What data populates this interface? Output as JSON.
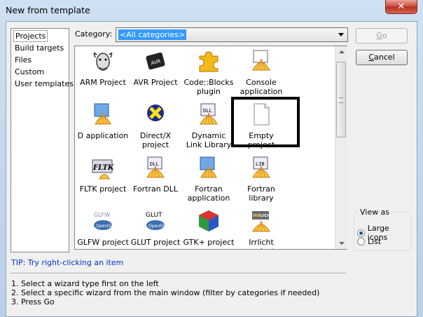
{
  "window": {
    "title": "New from template",
    "close_glyph": "✕"
  },
  "sidebar": {
    "items": [
      {
        "label": "Projects",
        "selected": true
      },
      {
        "label": "Build targets"
      },
      {
        "label": "Files"
      },
      {
        "label": "Custom"
      },
      {
        "label": "User templates"
      }
    ]
  },
  "category": {
    "label": "Category:",
    "value": "<All categories>"
  },
  "templates": [
    {
      "label": "ARM Project",
      "icon": "gnu-icon"
    },
    {
      "label": "AVR Project",
      "icon": "avr-chip-icon"
    },
    {
      "label": "Code::Blocks plugin",
      "icon": "puzzle-icon"
    },
    {
      "label": "Console application",
      "icon": "console-app-icon"
    },
    {
      "label": "D application",
      "icon": "d-app-icon"
    },
    {
      "label": "Direct/X project",
      "icon": "directx-icon"
    },
    {
      "label": "Dynamic Link Library",
      "icon": "dll-icon"
    },
    {
      "label": "Empty project",
      "icon": "blank-page-icon",
      "highlighted": true
    },
    {
      "label": "FLTK project",
      "icon": "fltk-icon"
    },
    {
      "label": "Fortran DLL",
      "icon": "fortran-dll-icon"
    },
    {
      "label": "Fortran application",
      "icon": "fortran-app-icon"
    },
    {
      "label": "Fortran library",
      "icon": "fortran-lib-icon"
    },
    {
      "label": "GLFW project",
      "icon": "glfw-icon"
    },
    {
      "label": "GLUT project",
      "icon": "glut-icon"
    },
    {
      "label": "GTK+ project",
      "icon": "gtk-icon"
    },
    {
      "label": "Irrlicht project",
      "icon": "irrlicht-icon"
    }
  ],
  "icon_text": {
    "avr": "AVR",
    "dll": "DLL",
    "lib": "LIB",
    "fltk": "FLTK",
    "glfw": "GLFW",
    "opengl": "OpenGL",
    "glut": "GLUT",
    "irr": "IRR",
    "licht": "LICHT"
  },
  "buttons": {
    "go": "Go",
    "cancel": "Cancel"
  },
  "view_as": {
    "legend": "View as",
    "options": [
      {
        "label": "Large icons",
        "selected": true
      },
      {
        "label": "List",
        "selected": false
      }
    ]
  },
  "tip": "TIP: Try right-clicking an item",
  "instructions": [
    "1. Select a wizard type first on the left",
    "2. Select a specific wizard from the main window (filter by categories if needed)",
    "3. Press Go"
  ],
  "colors": {
    "shell_yellow": "#f5c542",
    "shell_orange": "#e0891e",
    "tip_blue": "#0033cc",
    "selection_blue": "#3399ff"
  }
}
